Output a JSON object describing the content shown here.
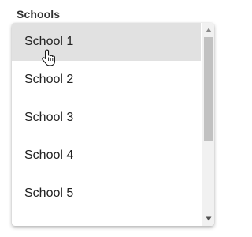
{
  "field": {
    "label": "Schools"
  },
  "dropdown": {
    "options": [
      {
        "label": "School 1"
      },
      {
        "label": "School 2"
      },
      {
        "label": "School 3"
      },
      {
        "label": "School 4"
      },
      {
        "label": "School 5"
      }
    ],
    "hovered_option": "School 1"
  },
  "scrollbar": {
    "up_icon": "triangle-up-icon",
    "down_icon": "triangle-down-icon"
  },
  "cursor": {
    "icon": "hand-pointer-icon"
  },
  "colors": {
    "hover_background": "#e1e1e1",
    "scroll_track": "#f1f1f1",
    "scroll_thumb": "#c1c1c1"
  }
}
